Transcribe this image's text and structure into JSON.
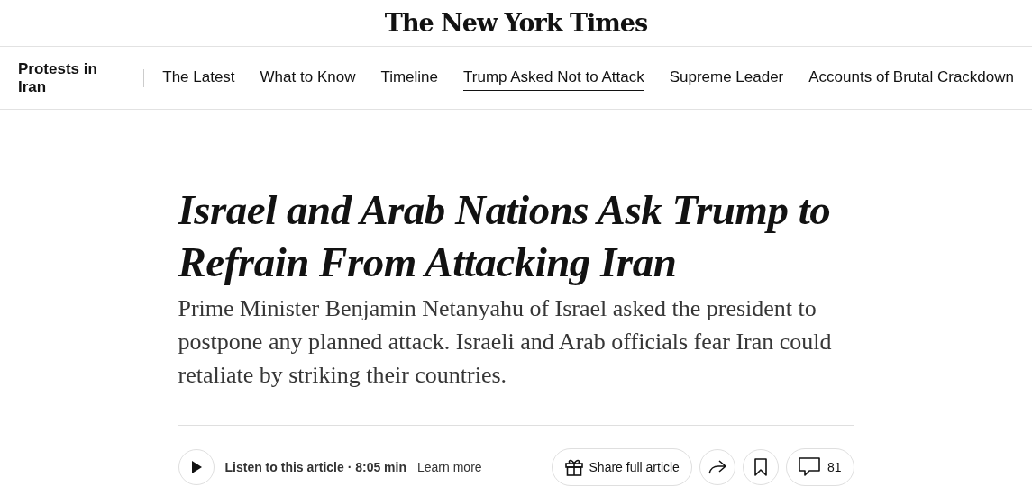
{
  "masthead": {
    "logo": "The New York Times"
  },
  "topic_nav": {
    "title": "Protests in Iran",
    "items": [
      {
        "label": "The Latest",
        "selected": false
      },
      {
        "label": "What to Know",
        "selected": false
      },
      {
        "label": "Timeline",
        "selected": false
      },
      {
        "label": "Trump Asked Not to Attack",
        "selected": true
      },
      {
        "label": "Supreme Leader",
        "selected": false
      },
      {
        "label": "Accounts of Brutal Crackdown",
        "selected": false
      }
    ]
  },
  "article": {
    "headline": "Israel and Arab Nations Ask Trump to Refrain From Attacking Iran",
    "summary": "Prime Minister Benjamin Netanyahu of Israel asked the president to postpone any planned attack. Israeli and Arab officials fear Iran could retaliate by striking their countries.",
    "audio": {
      "label": "Listen to this article · 8:05 min",
      "link": "Learn more"
    },
    "share": {
      "label": "Share full article"
    },
    "comments": {
      "count": "81"
    }
  }
}
